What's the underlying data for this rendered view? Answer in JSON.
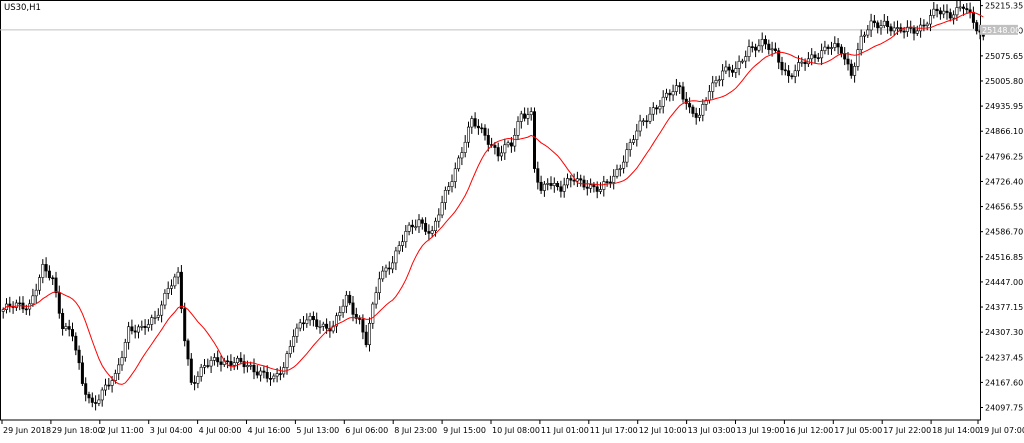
{
  "chart_data": {
    "type": "candlestick",
    "symbol": "US30,H1",
    "current_price_label": "25148.00",
    "current_price": 25148.0,
    "ylim": [
      24063,
      25231
    ],
    "y_ticks": [
      25215.35,
      25145.5,
      25075.65,
      25005.8,
      24935.95,
      24866.1,
      24796.25,
      24726.4,
      24656.55,
      24586.7,
      24516.85,
      24447.0,
      24377.15,
      24307.3,
      24237.45,
      24167.6,
      24097.75
    ],
    "y_tick_labels": [
      "25215.35",
      "25145.50",
      "25075.65",
      "25005.80",
      "24935.95",
      "24866.10",
      "24796.25",
      "24726.40",
      "24656.55",
      "24586.70",
      "24516.85",
      "24447.00",
      "24377.15",
      "24307.30",
      "24237.45",
      "24167.60",
      "24097.75"
    ],
    "x_tick_labels": [
      "29 Jun 2018",
      "29 Jun 18:00",
      "2 Jul 11:00",
      "3 Jul 04:00",
      "4 Jul 00:00",
      "4 Jul 16:00",
      "5 Jul 13:00",
      "6 Jul 06:00",
      "8 Jul 23:00",
      "9 Jul 15:00",
      "10 Jul 08:00",
      "11 Jul 01:00",
      "11 Jul 17:00",
      "12 Jul 10:00",
      "13 Jul 03:00",
      "13 Jul 19:00",
      "16 Jul 12:00",
      "17 Jul 05:00",
      "17 Jul 22:00",
      "18 Jul 14:00",
      "19 Jul 07:00"
    ],
    "price_path": [
      {
        "bar": 0,
        "price": 24370
      },
      {
        "bar": 4,
        "price": 24380
      },
      {
        "bar": 8,
        "price": 24385
      },
      {
        "bar": 12,
        "price": 24480
      },
      {
        "bar": 15,
        "price": 24455
      },
      {
        "bar": 18,
        "price": 24330
      },
      {
        "bar": 21,
        "price": 24300
      },
      {
        "bar": 24,
        "price": 24160
      },
      {
        "bar": 27,
        "price": 24110
      },
      {
        "bar": 30,
        "price": 24140
      },
      {
        "bar": 34,
        "price": 24180
      },
      {
        "bar": 38,
        "price": 24320
      },
      {
        "bar": 42,
        "price": 24310
      },
      {
        "bar": 46,
        "price": 24350
      },
      {
        "bar": 50,
        "price": 24430
      },
      {
        "bar": 53,
        "price": 24460
      },
      {
        "bar": 55,
        "price": 24290
      },
      {
        "bar": 57,
        "price": 24170
      },
      {
        "bar": 61,
        "price": 24210
      },
      {
        "bar": 65,
        "price": 24230
      },
      {
        "bar": 70,
        "price": 24225
      },
      {
        "bar": 74,
        "price": 24210
      },
      {
        "bar": 78,
        "price": 24200
      },
      {
        "bar": 82,
        "price": 24170
      },
      {
        "bar": 85,
        "price": 24210
      },
      {
        "bar": 88,
        "price": 24310
      },
      {
        "bar": 92,
        "price": 24340
      },
      {
        "bar": 96,
        "price": 24330
      },
      {
        "bar": 100,
        "price": 24320
      },
      {
        "bar": 104,
        "price": 24400
      },
      {
        "bar": 108,
        "price": 24340
      },
      {
        "bar": 110,
        "price": 24280
      },
      {
        "bar": 114,
        "price": 24460
      },
      {
        "bar": 118,
        "price": 24510
      },
      {
        "bar": 122,
        "price": 24580
      },
      {
        "bar": 126,
        "price": 24620
      },
      {
        "bar": 130,
        "price": 24580
      },
      {
        "bar": 134,
        "price": 24690
      },
      {
        "bar": 138,
        "price": 24790
      },
      {
        "bar": 142,
        "price": 24890
      },
      {
        "bar": 146,
        "price": 24860
      },
      {
        "bar": 150,
        "price": 24800
      },
      {
        "bar": 154,
        "price": 24830
      },
      {
        "bar": 157,
        "price": 24920
      },
      {
        "bar": 160,
        "price": 24910
      },
      {
        "bar": 161,
        "price": 24760
      },
      {
        "bar": 163,
        "price": 24690
      },
      {
        "bar": 165,
        "price": 24730
      },
      {
        "bar": 169,
        "price": 24710
      },
      {
        "bar": 173,
        "price": 24730
      },
      {
        "bar": 177,
        "price": 24720
      },
      {
        "bar": 181,
        "price": 24700
      },
      {
        "bar": 185,
        "price": 24740
      },
      {
        "bar": 189,
        "price": 24810
      },
      {
        "bar": 193,
        "price": 24880
      },
      {
        "bar": 197,
        "price": 24930
      },
      {
        "bar": 201,
        "price": 24960
      },
      {
        "bar": 205,
        "price": 24990
      },
      {
        "bar": 208,
        "price": 24930
      },
      {
        "bar": 211,
        "price": 24900
      },
      {
        "bar": 214,
        "price": 24980
      },
      {
        "bar": 218,
        "price": 25040
      },
      {
        "bar": 222,
        "price": 25030
      },
      {
        "bar": 226,
        "price": 25100
      },
      {
        "bar": 230,
        "price": 25110
      },
      {
        "bar": 234,
        "price": 25080
      },
      {
        "bar": 238,
        "price": 25020
      },
      {
        "bar": 242,
        "price": 25050
      },
      {
        "bar": 246,
        "price": 25080
      },
      {
        "bar": 250,
        "price": 25100
      },
      {
        "bar": 254,
        "price": 25090
      },
      {
        "bar": 257,
        "price": 25030
      },
      {
        "bar": 260,
        "price": 25120
      },
      {
        "bar": 263,
        "price": 25160
      },
      {
        "bar": 267,
        "price": 25170
      },
      {
        "bar": 271,
        "price": 25140
      },
      {
        "bar": 275,
        "price": 25150
      },
      {
        "bar": 279,
        "price": 25160
      },
      {
        "bar": 283,
        "price": 25200
      },
      {
        "bar": 287,
        "price": 25195
      },
      {
        "bar": 291,
        "price": 25210
      },
      {
        "bar": 294,
        "price": 25170
      },
      {
        "bar": 297,
        "price": 25130
      }
    ],
    "gap_after_bars": [
      42,
      160
    ],
    "moving_average_color": "#ff0000",
    "bull_candle_color": "#ffffff",
    "bear_candle_color": "#000000",
    "candle_wick_color": "#000000",
    "current_price_line_color": "#c0c0c0",
    "grid": false
  }
}
